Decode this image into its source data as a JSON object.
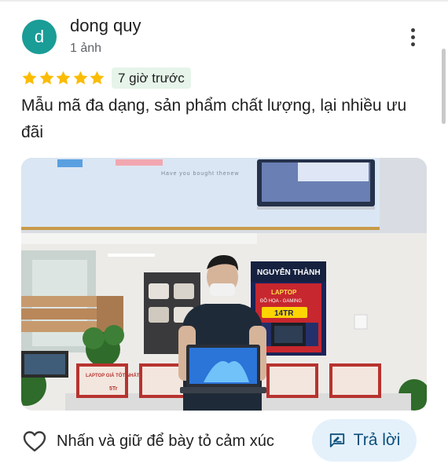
{
  "review": {
    "author_initial": "d",
    "author_name": "dong quy",
    "photo_count": "1 ảnh",
    "rating": 5,
    "time_ago": "7 giờ trước",
    "text": "Mẫu mã đa dạng, sản phẩm chất lượng, lại nhiều ưu đãi"
  },
  "photo": {
    "signage": {
      "banner_text": "Have you bought thenew",
      "store_name": "NGUYỄN THÀNH",
      "promo_heading": "LAPTOP",
      "promo_sub": "ĐỒ HỌA - GAMING",
      "promo_price": "14TR",
      "display_label": "LAPTOP GIÁ TỐT NHẤT",
      "display_sub": "5Tr"
    }
  },
  "actions": {
    "react_label": "Nhấn và giữ để bày tỏ cảm xúc",
    "reply_label": "Trả lời"
  },
  "colors": {
    "avatar_bg": "#1a9c97",
    "star": "#fbbc04",
    "time_badge_bg": "#e6f4ea",
    "reply_bg": "#e4f1fb",
    "reply_text": "#0b4f7c"
  },
  "icons": {
    "more": "more-vert-icon",
    "star": "star-icon",
    "react": "heart-outline-icon",
    "reply": "reply-chat-icon"
  }
}
